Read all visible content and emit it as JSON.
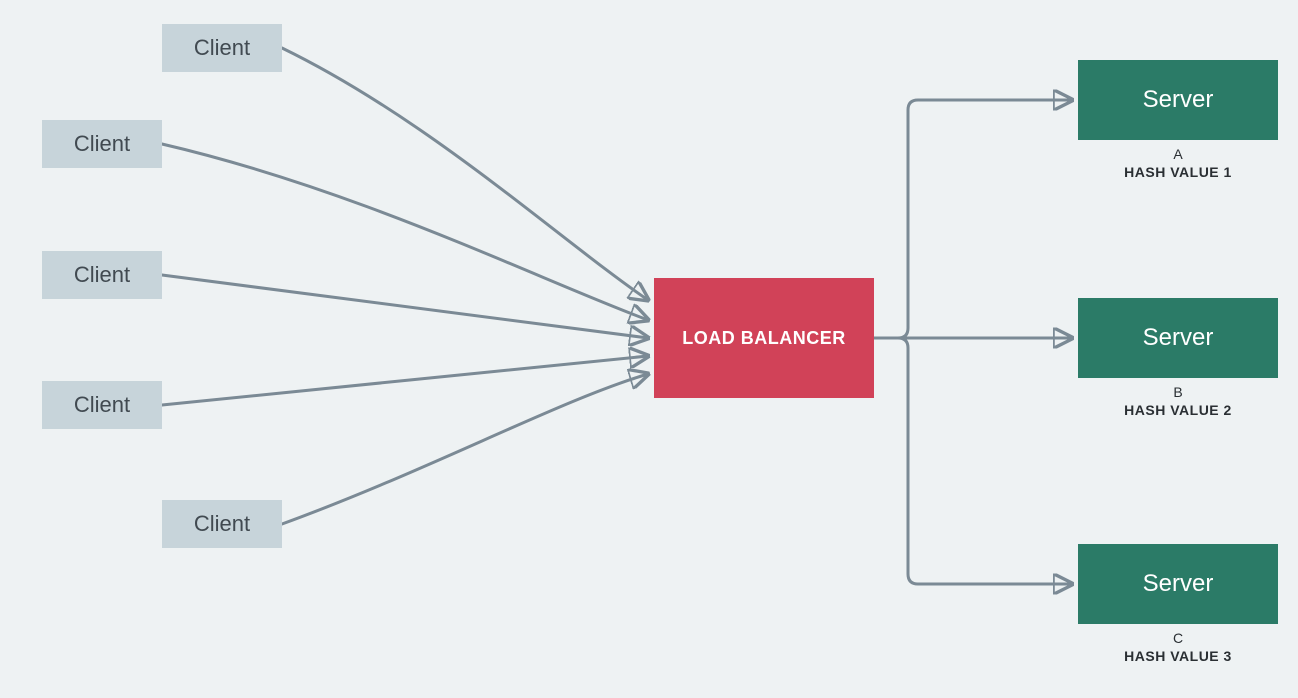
{
  "clients": [
    {
      "label": "Client"
    },
    {
      "label": "Client"
    },
    {
      "label": "Client"
    },
    {
      "label": "Client"
    },
    {
      "label": "Client"
    }
  ],
  "loadBalancer": {
    "label": "LOAD BALANCER"
  },
  "servers": [
    {
      "label": "Server",
      "letter": "A",
      "hash": "HASH VALUE 1"
    },
    {
      "label": "Server",
      "letter": "B",
      "hash": "HASH VALUE 2"
    },
    {
      "label": "Server",
      "letter": "C",
      "hash": "HASH VALUE 3"
    }
  ],
  "colors": {
    "client_bg": "#c7d4da",
    "lb_bg": "#d14258",
    "server_bg": "#2b7b67",
    "line": "#7b8a95",
    "page_bg": "#eef2f3"
  }
}
